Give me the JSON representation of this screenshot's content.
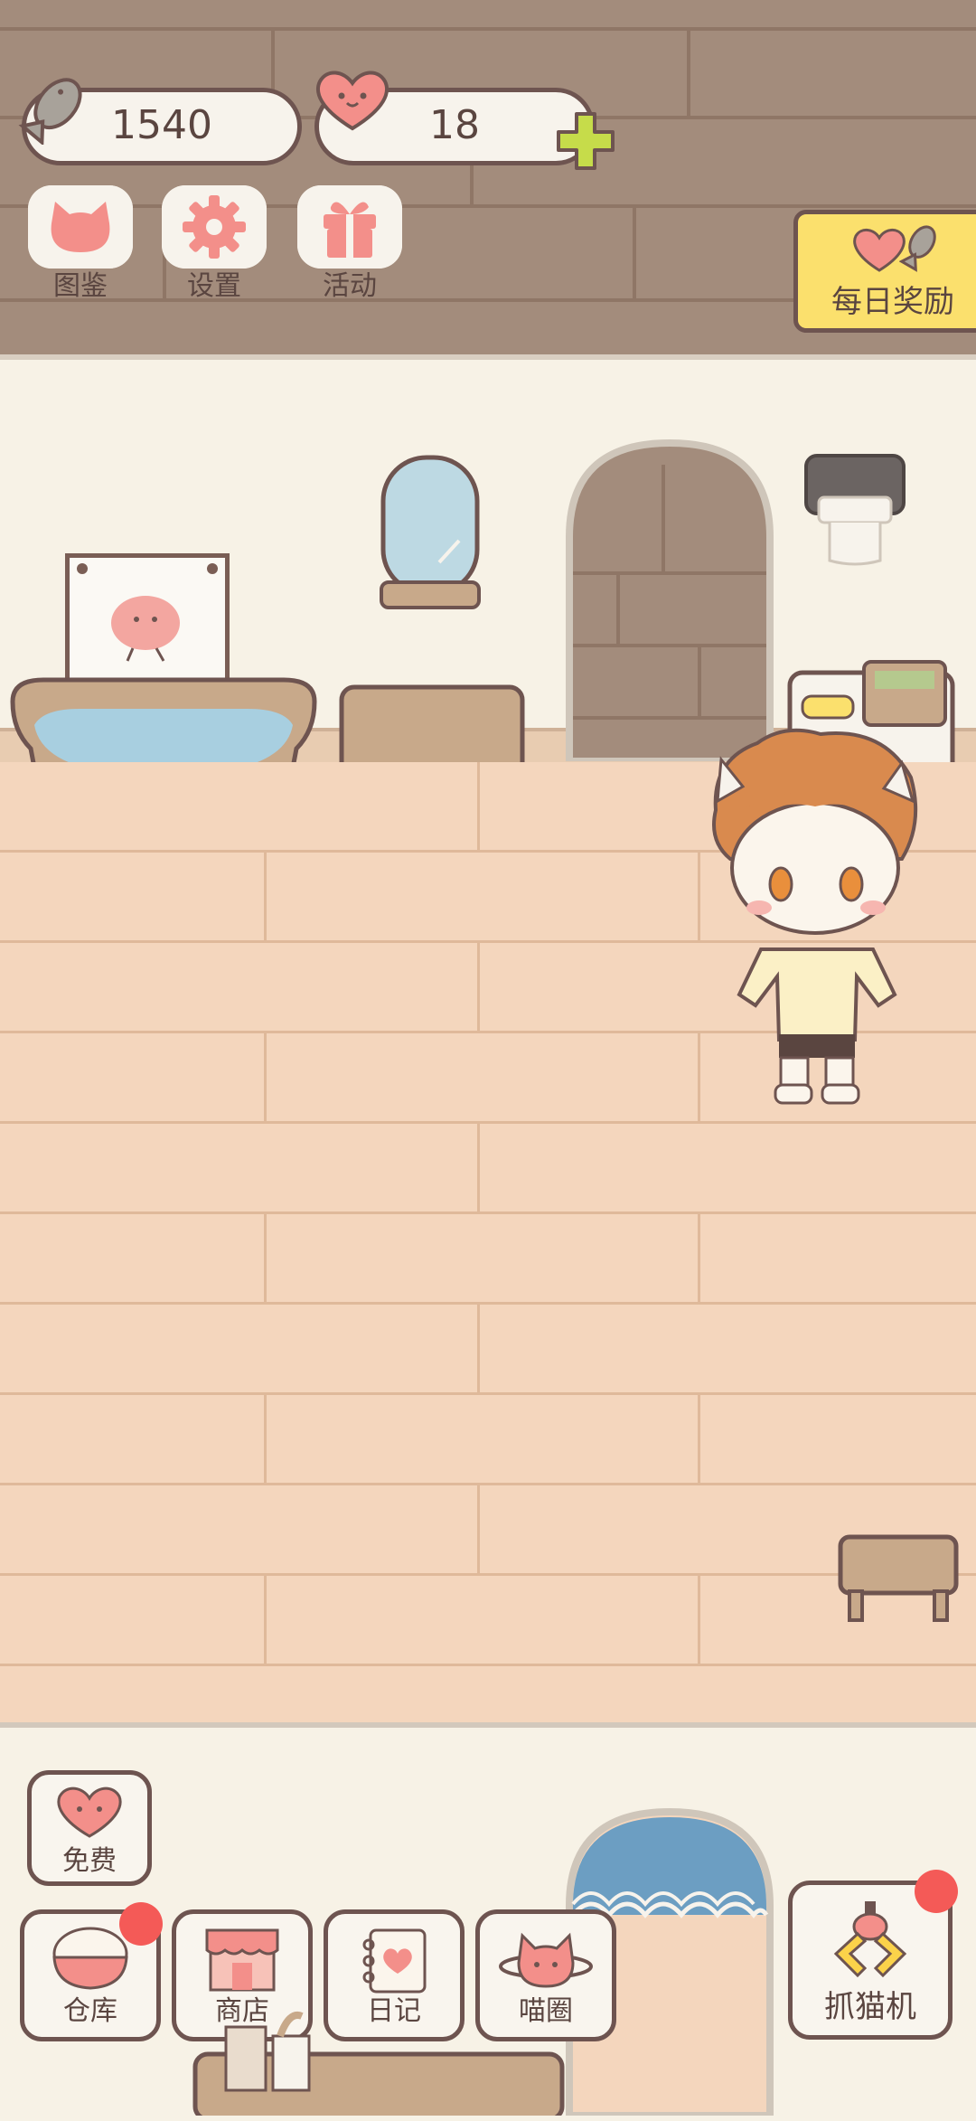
{
  "currency": {
    "fish_value": "1540",
    "hearts_value": "18"
  },
  "menu": {
    "collection_label": "图鉴",
    "settings_label": "设置",
    "events_label": "活动"
  },
  "daily_reward_label": "每日奖励",
  "bottom_nav": {
    "free_label": "免费",
    "warehouse_label": "仓库",
    "shop_label": "商店",
    "diary_label": "日记",
    "cat_circle_label": "喵圈",
    "claw_machine_label": "抓猫机"
  },
  "colors": {
    "accent_pink": "#f38f8a",
    "accent_yellow": "#fbe06d",
    "outline": "#6e5450",
    "notification": "#f45a57"
  },
  "icons": {
    "fish": "fish-icon",
    "heart": "heart-icon",
    "plus": "plus-icon",
    "cat_head": "cat-head-icon",
    "gear": "gear-icon",
    "gift": "gift-icon"
  }
}
